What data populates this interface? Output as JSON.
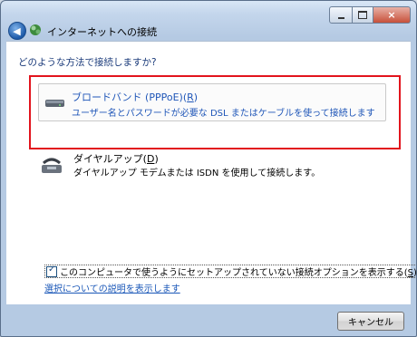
{
  "window": {
    "title": "インターネットへの接続",
    "title_icon": "network-icon",
    "controls": {
      "minimize": "minimize-icon",
      "maximize": "maximize-icon",
      "close": "×"
    }
  },
  "content": {
    "question": "どのような方法で接続しますか?",
    "options": [
      {
        "title": "ブロードバンド (PPPoE)(",
        "mnemonic": "R",
        "title_end": ")",
        "description": "ユーザー名とパスワードが必要な DSL またはケーブルを使って接続します",
        "icon": "broadband-modem-icon"
      },
      {
        "title": "ダイヤルアップ(",
        "mnemonic": "D",
        "title_end": ")",
        "description": "ダイヤルアップ モデムまたは ISDN を使用して接続します。",
        "icon": "dialup-modem-icon"
      }
    ],
    "checkbox": {
      "label": "このコンピュータで使うようにセットアップされていない接続オプションを表示する(",
      "mnemonic": "S",
      "label_end": ")",
      "checked": true
    },
    "help_link": "選択についての説明を表示します"
  },
  "footer": {
    "cancel_label": "キャンセル"
  },
  "colors": {
    "highlight_border": "#e2141d",
    "link": "#1f56b8",
    "question": "#1a3a7a"
  }
}
